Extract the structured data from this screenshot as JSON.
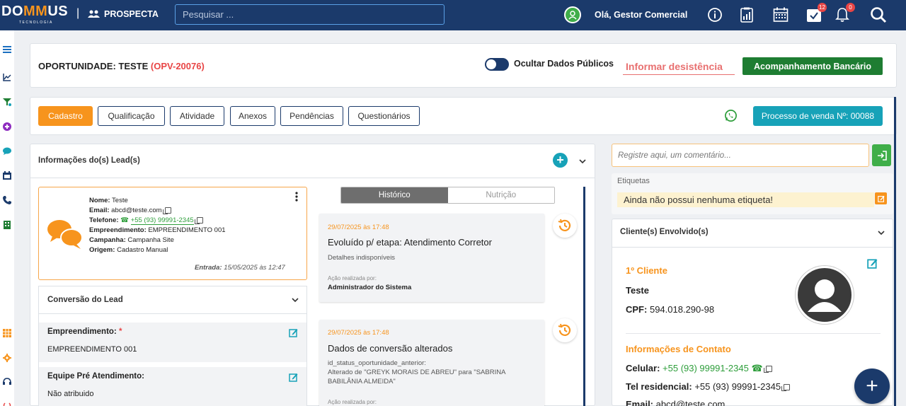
{
  "header": {
    "logo_text": [
      "DO",
      "MM",
      "US"
    ],
    "logo_subtitle": "TECNOLOGIA",
    "module": "PROSPECTA",
    "search_placeholder": "Pesquisar ...",
    "greeting": "Olá, Gestor Comercial",
    "badges": {
      "tasks": "12",
      "notifications": "0"
    }
  },
  "opportunity": {
    "title_prefix": "OPORTUNIDADE: TESTE",
    "code": "(OPV-20076)",
    "toggle_label": "Ocultar Dados Públicos",
    "desistencia_label": "Informar desistência",
    "bancario_label": "Acompanhamento Bancário"
  },
  "tabs": [
    {
      "label": "Cadastro",
      "active": true
    },
    {
      "label": "Qualificação",
      "active": false
    },
    {
      "label": "Atividade",
      "active": false
    },
    {
      "label": "Anexos",
      "active": false
    },
    {
      "label": "Pendências",
      "active": false
    },
    {
      "label": "Questionários",
      "active": false
    }
  ],
  "processo_label": "Processo de venda Nº: 00088",
  "lead_section": {
    "title": "Informações do(s) Lead(s)",
    "card": {
      "nome_label": "Nome:",
      "nome": "Teste",
      "email_label": "Email:",
      "email": "abcd@teste.com",
      "telefone_label": "Telefone:",
      "telefone": "+55 (93) 99991-2345",
      "empreendimento_label": "Empreendimento:",
      "empreendimento": "EMPREENDIMENTO 001",
      "campanha_label": "Campanha:",
      "campanha": "Campanha Site",
      "origem_label": "Origem:",
      "origem": "Cadastro Manual",
      "entrada_label": "Entrada:",
      "entrada": "15/05/2025 às 12:47"
    }
  },
  "conversao": {
    "title": "Conversão do Lead",
    "fields": [
      {
        "label": "Empreendimento:",
        "required": "*",
        "value": "EMPREENDIMENTO 001"
      },
      {
        "label": "Equipe Pré Atendimento:",
        "required": "",
        "value": "Não atribuido"
      }
    ]
  },
  "history": {
    "tabs": [
      "Histórico",
      "Nutrição"
    ],
    "items": [
      {
        "date": "29/07/2025 às 17:48",
        "title": "Evoluído p/ etapa: Atendimento Corretor",
        "desc": [
          "Detalhes indisponíveis"
        ],
        "action_label": "Ação realizada por:",
        "by": "Administrador do Sistema"
      },
      {
        "date": "29/07/2025 às 17:48",
        "title": "Dados de conversão alterados",
        "desc": [
          "id_status_oportunidade_anterior:",
          "Alterado de \"GREYK MORAIS DE ABREU\" para \"SABRINA",
          "BABILÂNIA ALMEIDA\""
        ],
        "action_label": "Ação realizada por:",
        "by": ""
      }
    ]
  },
  "right": {
    "comment_placeholder": "Registre aqui, um comentário...",
    "etiquetas_label": "Etiquetas",
    "etiquetas_empty": "Ainda não possui nenhuma etiqueta!",
    "clientes_title": "Cliente(s) Envolvido(s)",
    "cliente": {
      "heading": "1º Cliente",
      "name": "Teste",
      "cpf_label": "CPF:",
      "cpf": "594.018.290-98",
      "contato_heading": "Informações de Contato",
      "celular_label": "Celular:",
      "celular": "+55 (93) 99991-2345",
      "tel_label": "Tel residencial:",
      "tel": "+55 (93) 99991-2345",
      "email_label": "Email:",
      "email": "abcd@teste.com"
    }
  },
  "colors": {
    "navy": "#1b3a6b",
    "orange": "#f7941d",
    "green": "#1e7d32",
    "teal": "#17a2b8",
    "red": "#e84545"
  }
}
